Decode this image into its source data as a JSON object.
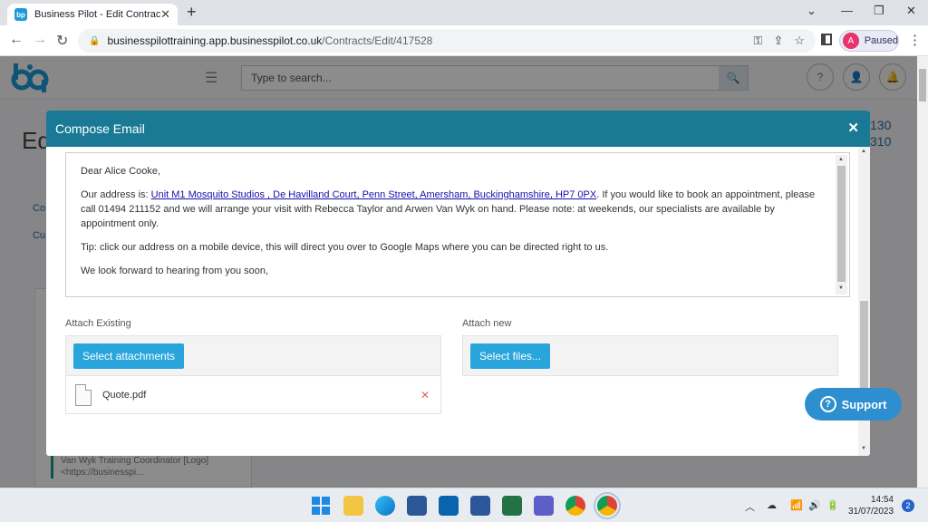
{
  "browser": {
    "tab_title": "Business Pilot - Edit Contract",
    "favicon_text": "bp",
    "url_host": "businesspilottraining.app.businesspilot.co.uk",
    "url_path": "/Contracts/Edit/417528",
    "profile_initial": "A",
    "profile_status": "Paused"
  },
  "app": {
    "search_placeholder": "Type to search...",
    "bg_title": "Ed",
    "bg_num1": "130",
    "bg_num2": "310",
    "bg_link1": "Co",
    "bg_link2": "Cu",
    "bg_note": "Van Wyk Training Coordinator [Logo] <https://businesspi..."
  },
  "modal": {
    "title": "Compose Email",
    "greeting": "Dear Alice Cooke,",
    "address_prefix": "Our address is: ",
    "address_link": "Unit M1 Mosquito Studios , De Havilland Court, Penn Street, Amersham, Buckinghamshire, HP7 0PX",
    "address_suffix": ". If you would like to book an appointment, please call 01494 211152 and we will arrange your visit with Rebecca Taylor and Arwen Van Wyk on hand. Please note: at weekends, our specialists are available by appointment only.",
    "tip": "Tip: click our address on a mobile device, this will direct you over to Google Maps where you can be directed right to us.",
    "closing": "We look forward to hearing from you soon,",
    "attach_existing_label": "Attach Existing",
    "attach_new_label": "Attach new",
    "select_attachments_label": "Select attachments",
    "select_files_label": "Select files...",
    "file_name": "Quote.pdf"
  },
  "support": {
    "label": "Support"
  },
  "taskbar": {
    "time": "14:54",
    "date": "31/07/2023",
    "notifications": "2"
  }
}
